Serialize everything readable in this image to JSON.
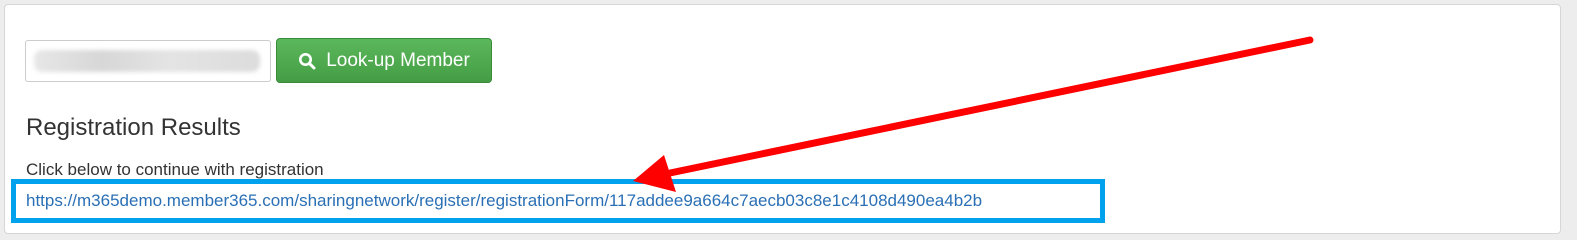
{
  "search": {
    "value": "",
    "placeholder": ""
  },
  "lookup_button": {
    "label": "Look-up Member",
    "icon": "search-icon"
  },
  "results": {
    "title": "Registration Results",
    "instruction": "Click below to continue with registration",
    "link": "https://m365demo.member365.com/sharingnetwork/register/registrationForm/117addee9a664c7aecb03c8e1c4108d490ea4b2b"
  },
  "colors": {
    "button_green": "#5cb85c",
    "link_blue": "#2a6fb5",
    "highlight_box": "#00a2ed",
    "annotation_arrow": "#ff0000"
  }
}
